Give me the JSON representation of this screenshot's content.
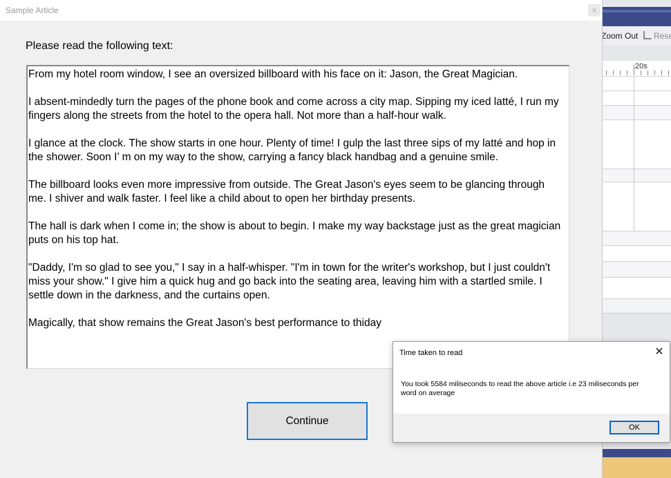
{
  "window": {
    "title": "Sample Article",
    "close_glyph": "x"
  },
  "instruction": "Please read the following text:",
  "article": {
    "paragraphs": [
      "From my hotel room window, I see an oversized billboard with his face on it: Jason, the Great Magician.",
      "I absent-mindedly turn the pages of the phone book and come across a city map. Sipping my iced latté, I run my fingers along the streets from the hotel to the opera hall. Not more than a half-hour walk.",
      "I glance at the clock. The show starts in one hour. Plenty of time! I gulp the last three sips of my latté and hop in the shower. Soon I’ m on my way to the show, carrying a fancy black handbag and a genuine smile.",
      "The billboard looks even more impressive from outside. The Great Jason's eyes seem to be glancing through me. I shiver and walk faster. I feel like a child about to open her birthday presents.",
      "The hall is dark when I come in; the show is about to begin. I make my way backstage just as the great magician puts on his top hat.",
      "\"Daddy, I'm so glad to see you,\" I say in a half-whisper. \"I'm in town for the writer's workshop, but I just couldn't miss your show.\" I give him a quick hug and go back into the seating area, leaving him with a startled smile. I settle down in the darkness, and the curtains open.",
      "Magically, that show remains the Great Jason's best performance to thiday"
    ]
  },
  "continue_label": "Continue",
  "dialog": {
    "title": "Time taken to read",
    "close_glyph": "✕",
    "message": "You took 5584 miliseconds to read the above article i.e 23 miliseconds per word on average",
    "ok_label": "OK"
  },
  "background_app": {
    "zoom_out_label": "Zoom Out",
    "reset_label": "Rese",
    "ruler_label": "20s"
  },
  "colors": {
    "accent_blue": "#1976d2",
    "background_title_bar": "#3c4a8a",
    "background_bottom_bar": "#efc77a"
  }
}
